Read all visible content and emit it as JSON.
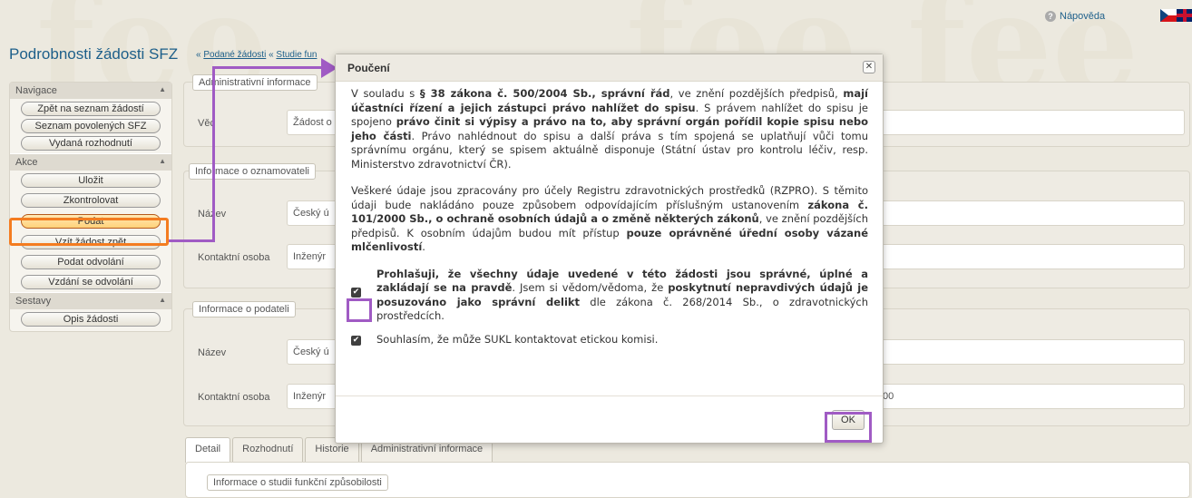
{
  "header": {
    "title": "Podrobnosti žádosti SFZ",
    "breadcrumb_sep1": " « ",
    "breadcrumb_link1": "Podané žádosti",
    "breadcrumb_sep2": " « ",
    "breadcrumb_link2": "Studie fun",
    "help_label": "Nápověda",
    "lang_flags": [
      "flag-cz-icon",
      "flag-en-icon"
    ]
  },
  "nav": {
    "sections": [
      {
        "title": "Navigace",
        "items": [
          "Zpět na seznam žádostí",
          "Seznam povolených SFZ",
          "Vydaná rozhodnutí"
        ]
      },
      {
        "title": "Akce",
        "items": [
          "Uložit",
          "Zkontrolovat",
          "Podat",
          "Vzít žádost zpět",
          "Podat odvolání",
          "Vzdání se odvolání"
        ]
      },
      {
        "title": "Sestavy",
        "items": [
          "Opis žádosti"
        ]
      }
    ]
  },
  "panels": {
    "admin_legend": "Administrativní informace",
    "vec_label": "Věc",
    "vec_value": "Žádost o",
    "oznam_legend": "Informace o oznamovateli",
    "nazev_label": "Název",
    "nazev_value": "Český ú",
    "kontakt_label": "Kontaktní osoba",
    "kontakt_value": "Inženýr",
    "podatel_legend": "Informace o podateli",
    "nazev2_label": "Název",
    "nazev2_value": "Český ú",
    "kontakt2_label": "Kontaktní osoba",
    "kontakt2_value": "Inženýr",
    "kontakt2_tail": "00",
    "study_legend": "Informace o studii funkční způsobilosti"
  },
  "tabs": [
    "Detail",
    "Rozhodnutí",
    "Historie",
    "Administrativní informace"
  ],
  "modal": {
    "title": "Poučení",
    "close_glyph": "✕",
    "p1": [
      {
        "t": "V souladu s "
      },
      {
        "t": "§ 38 zákona č. 500/2004 Sb., správní řád",
        "b": true
      },
      {
        "t": ", ve znění pozdějších předpisů, "
      },
      {
        "t": "mají účastníci řízení a jejich zástupci právo nahlížet do spisu",
        "b": true
      },
      {
        "t": ". S právem nahlížet do spisu je spojeno "
      },
      {
        "t": "právo činit si výpisy a právo na to, aby správní orgán pořídil kopie spisu nebo jeho části",
        "b": true
      },
      {
        "t": ". Právo nahlédnout do spisu a další práva s tím spojená se uplatňují vůči tomu správnímu orgánu, který se spisem aktuálně disponuje (Státní ústav pro kontrolu léčiv, resp. Ministerstvo zdravotnictví ČR)."
      }
    ],
    "p2": [
      {
        "t": "Veškeré údaje jsou zpracovány pro účely Registru zdravotnických prostředků (RZPRO). S těmito údaji bude nakládáno pouze způsobem odpovídajícím příslušným ustanovením "
      },
      {
        "t": "zákona č. 101/2000 Sb., o ochraně osobních údajů a o změně některých zákonů",
        "b": true
      },
      {
        "t": ", ve znění pozdějších předpisů. K osobním údajům budou mít přístup "
      },
      {
        "t": "pouze oprávněné úřední osoby vázané mlčenlivostí",
        "b": true
      },
      {
        "t": "."
      }
    ],
    "check1": [
      {
        "t": "Prohlašuji, že všechny údaje uvedené v této žádosti jsou správné, úplné a zakládají se na pravdě",
        "b": true
      },
      {
        "t": ". Jsem si vědom/vědoma, že "
      },
      {
        "t": "poskytnutí nepravdivých údajů je posuzováno jako správní delikt",
        "b": true
      },
      {
        "t": " dle zákona č. 268/2014 Sb., o zdravotnických prostředcích."
      }
    ],
    "check2": "Souhlasím, že může SUKL kontaktovat etickou komisi.",
    "ok_label": "OK",
    "check1_checked": true,
    "check2_checked": true
  },
  "colors": {
    "annotation": "#a05bc4",
    "highlight": "#f47c20",
    "link": "#1d5f8a"
  }
}
